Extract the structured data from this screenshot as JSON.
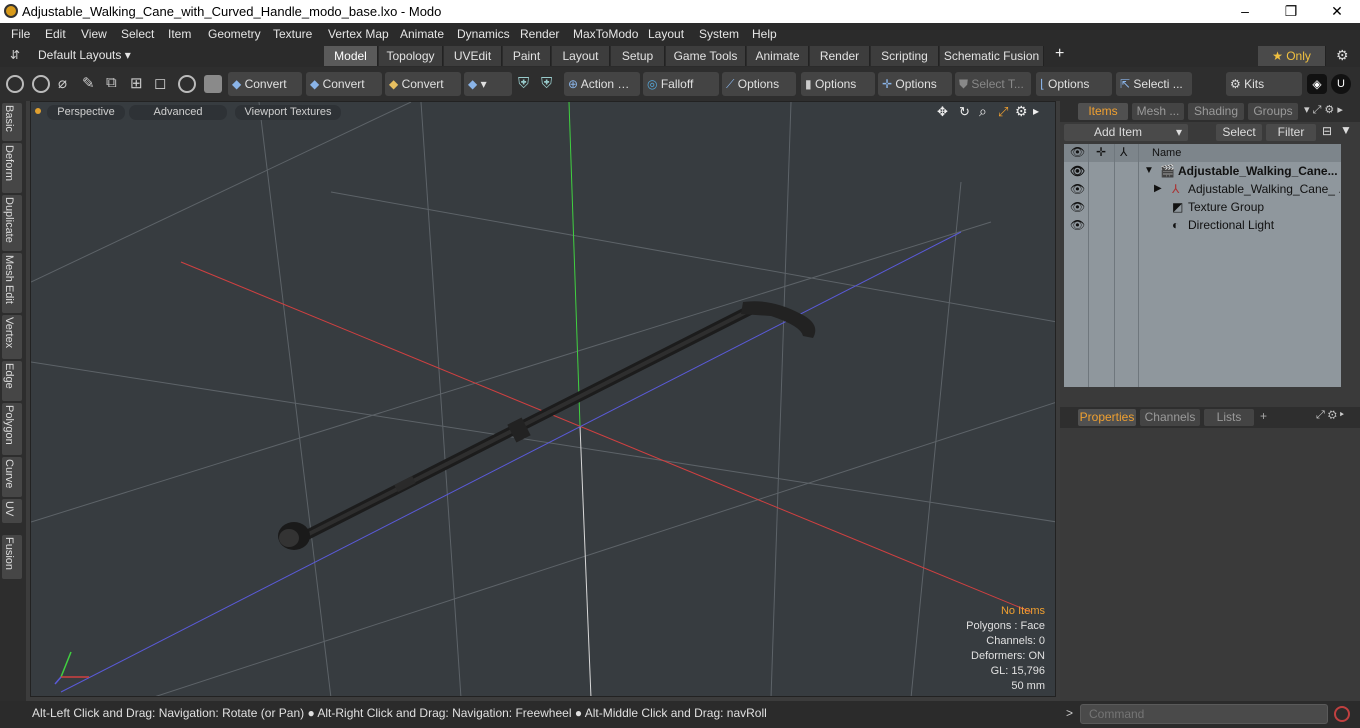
{
  "window": {
    "title": "Adjustable_Walking_Cane_with_Curved_Handle_modo_base.lxo - Modo",
    "minimize": "–",
    "maximize": "❐",
    "close": "✕"
  },
  "menu": [
    "File",
    "Edit",
    "View",
    "Select",
    "Item",
    "Geometry",
    "Texture",
    "Vertex Map",
    "Animate",
    "Dynamics",
    "Render",
    "MaxToModo",
    "Layout",
    "System",
    "Help"
  ],
  "layouts": {
    "label": "Default Layouts ▾"
  },
  "tabs": [
    "Model",
    "Topology",
    "UVEdit",
    "Paint",
    "Layout",
    "Setup",
    "Game Tools",
    "Animate",
    "Render",
    "Scripting",
    "Schematic Fusion"
  ],
  "tab_plus": "+",
  "only": "★  Only",
  "toolbar": {
    "convert1": "Convert",
    "convert2": "Convert",
    "convert3": "Convert",
    "action": "Action",
    "falloff": "Falloff",
    "options1": "Options",
    "options2": "Options",
    "options3": "Options",
    "select_t": "Select T...",
    "options4": "Options",
    "selecti": "Selecti ...",
    "kits": "Kits"
  },
  "left_tabs": [
    "Basic",
    "Deform",
    "Duplicate",
    "Mesh Edit",
    "Vertex",
    "Edge",
    "Polygon",
    "Curve",
    "UV",
    "Fusion"
  ],
  "viewport": {
    "perspective": "Perspective",
    "advanced": "Advanced",
    "textures": "Viewport Textures",
    "stats": {
      "no_items": "No Items",
      "polygons": "Polygons : Face",
      "channels": "Channels: 0",
      "deformers": "Deformers: ON",
      "gl": "GL: 15,796",
      "size": "50 mm"
    }
  },
  "items_panel": {
    "tabs": [
      "Items",
      "Mesh ...",
      "Shading",
      "Groups"
    ],
    "add_item": "Add Item",
    "select": "Select",
    "filter": "Filter",
    "name_header": "Name",
    "rows": [
      "Adjustable_Walking_Cane...",
      "Adjustable_Walking_Cane_ ...",
      "Texture Group",
      "Directional Light"
    ]
  },
  "props_panel": {
    "tabs": [
      "Properties",
      "Channels",
      "Lists"
    ],
    "plus": "+"
  },
  "status": {
    "text": "Alt-Left Click and Drag: Navigation: Rotate (or Pan) ● Alt-Right Click and Drag: Navigation: Freewheel ● Alt-Middle Click and Drag: navRoll",
    "command_placeholder": "Command"
  },
  "colors": {
    "accent": "#f0a030",
    "viewport_bg": "#373c40",
    "x_axis": "#d04040",
    "z_axis": "#5a5ad8",
    "y_axis": "#40d040"
  }
}
